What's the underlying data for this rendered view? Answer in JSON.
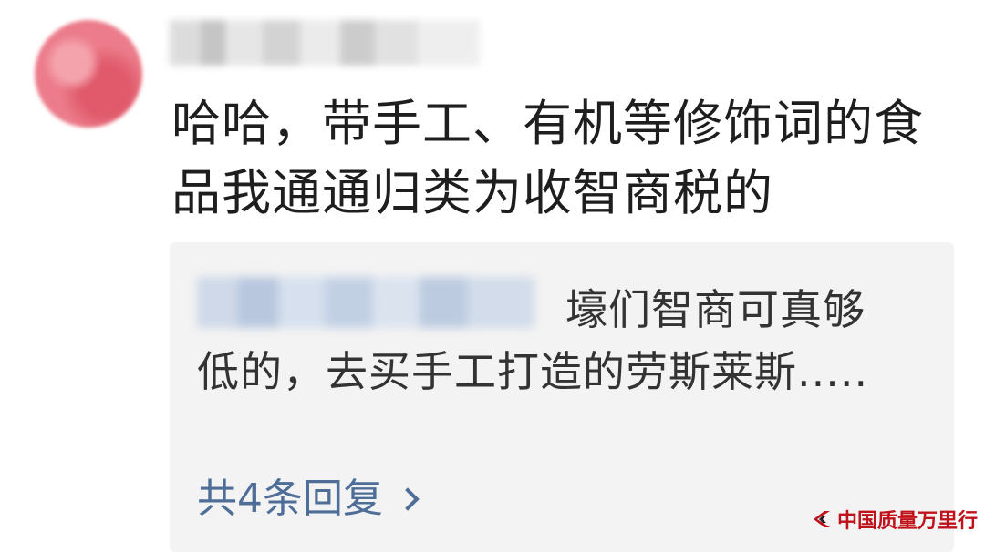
{
  "comment": {
    "text": "哈哈，带手工、有机等修饰词的食品我通通归类为收智商税的"
  },
  "reply": {
    "text": "壕们智商可真够低的，去买手工打造的劳斯莱斯.....",
    "count_label": "共4条回复"
  },
  "watermark": {
    "text": "中国质量万里行",
    "color": "#c0121a"
  },
  "colors": {
    "link": "#4e6e98",
    "reply_bg": "#f3f3f3"
  }
}
